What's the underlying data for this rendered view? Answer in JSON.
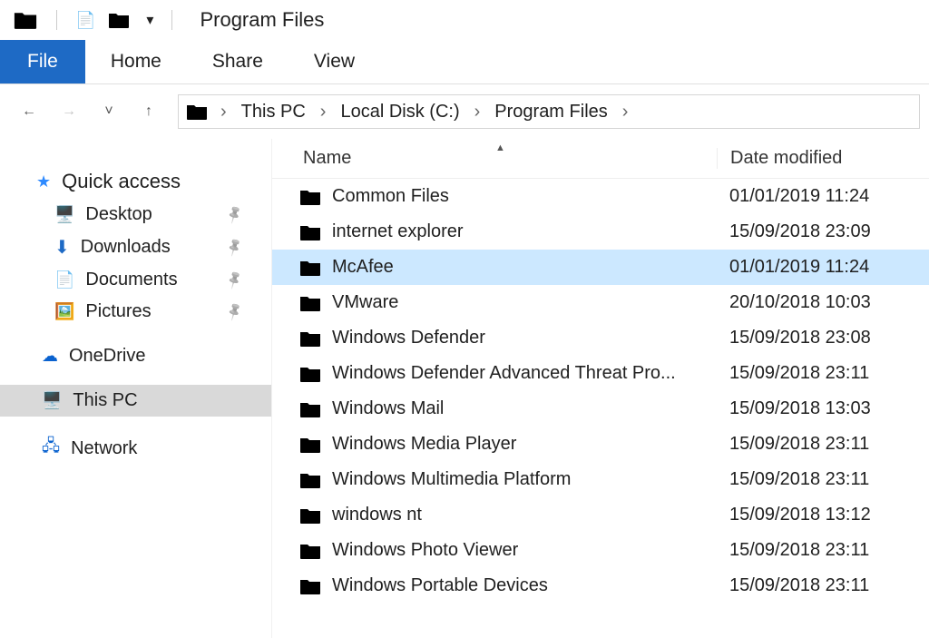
{
  "window": {
    "title": "Program Files"
  },
  "ribbon": {
    "file": "File",
    "home": "Home",
    "share": "Share",
    "view": "View"
  },
  "breadcrumb": {
    "c0": "This PC",
    "c1": "Local Disk (C:)",
    "c2": "Program Files"
  },
  "columns": {
    "name": "Name",
    "date": "Date modified"
  },
  "sidebar": {
    "quick_access": "Quick access",
    "desktop": "Desktop",
    "downloads": "Downloads",
    "documents": "Documents",
    "pictures": "Pictures",
    "onedrive": "OneDrive",
    "this_pc": "This PC",
    "network": "Network"
  },
  "rows": [
    {
      "name": "Common Files",
      "date": "01/01/2019 11:24",
      "sel": false
    },
    {
      "name": "internet explorer",
      "date": "15/09/2018 23:09",
      "sel": false
    },
    {
      "name": "McAfee",
      "date": "01/01/2019 11:24",
      "sel": true
    },
    {
      "name": "VMware",
      "date": "20/10/2018 10:03",
      "sel": false
    },
    {
      "name": "Windows Defender",
      "date": "15/09/2018 23:08",
      "sel": false
    },
    {
      "name": "Windows Defender Advanced Threat Pro...",
      "date": "15/09/2018 23:11",
      "sel": false
    },
    {
      "name": "Windows Mail",
      "date": "15/09/2018 13:03",
      "sel": false
    },
    {
      "name": "Windows Media Player",
      "date": "15/09/2018 23:11",
      "sel": false
    },
    {
      "name": "Windows Multimedia Platform",
      "date": "15/09/2018 23:11",
      "sel": false
    },
    {
      "name": "windows nt",
      "date": "15/09/2018 13:12",
      "sel": false
    },
    {
      "name": "Windows Photo Viewer",
      "date": "15/09/2018 23:11",
      "sel": false
    },
    {
      "name": "Windows Portable Devices",
      "date": "15/09/2018 23:11",
      "sel": false
    }
  ]
}
